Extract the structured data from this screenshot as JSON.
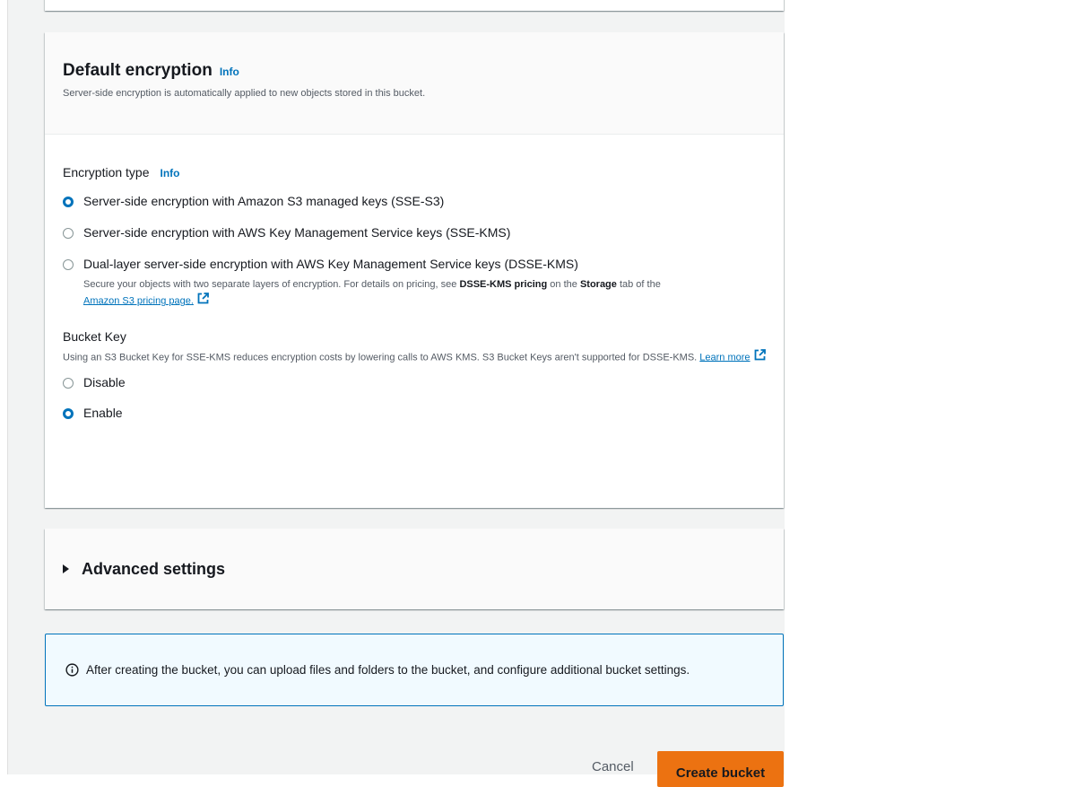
{
  "encryption": {
    "title": "Default encryption",
    "info": "Info",
    "description": "Server-side encryption is automatically applied to new objects stored in this bucket.",
    "type_label": "Encryption type",
    "type_info": "Info",
    "options": [
      {
        "label": "Server-side encryption with Amazon S3 managed keys (SSE-S3)",
        "selected": true
      },
      {
        "label": "Server-side encryption with AWS Key Management Service keys (SSE-KMS)",
        "selected": false
      },
      {
        "label": "Dual-layer server-side encryption with AWS Key Management Service keys (DSSE-KMS)",
        "selected": false
      }
    ],
    "dsse_desc_part1": "Secure your objects with two separate layers of encryption. For details on pricing, see ",
    "dsse_desc_bold1": "DSSE-KMS pricing",
    "dsse_desc_part2": " on the ",
    "dsse_desc_bold2": "Storage",
    "dsse_desc_part3": " tab of the",
    "dsse_link": "Amazon S3 pricing page.",
    "bucket_key": {
      "label": "Bucket Key",
      "description": "Using an S3 Bucket Key for SSE-KMS reduces encryption costs by lowering calls to AWS KMS. S3 Bucket Keys aren't supported for DSSE-KMS. ",
      "learn_more": "Learn more",
      "options": [
        {
          "label": "Disable",
          "selected": false
        },
        {
          "label": "Enable",
          "selected": true
        }
      ]
    }
  },
  "advanced": {
    "label": "Advanced settings"
  },
  "alert": {
    "text": "After creating the bucket, you can upload files and folders to the bucket, and configure additional bucket settings."
  },
  "actions": {
    "cancel": "Cancel",
    "create": "Create bucket"
  },
  "colors": {
    "accent": "#0073bb",
    "primary_button": "#ec7211",
    "alert_bg": "#f1faff"
  }
}
